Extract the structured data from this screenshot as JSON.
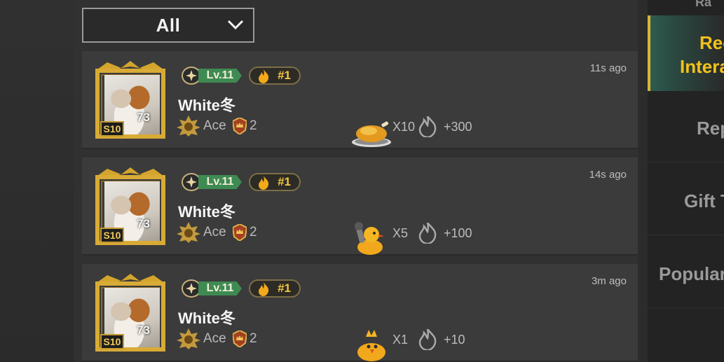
{
  "filter": {
    "selected": "All"
  },
  "entries": [
    {
      "level": "Lv.11",
      "rank": "#1",
      "username": "White冬",
      "tier": "Ace",
      "tier_number": "2",
      "avatar_score": "73",
      "season": "S10",
      "gift_icon": "roast-chicken-icon",
      "gift_count": "X10",
      "heat": "+300",
      "time_ago": "11s ago"
    },
    {
      "level": "Lv.11",
      "rank": "#1",
      "username": "White冬",
      "tier": "Ace",
      "tier_number": "2",
      "avatar_score": "73",
      "season": "S10",
      "gift_icon": "chick-with-pan-icon",
      "gift_count": "X5",
      "heat": "+100",
      "time_ago": "14s ago"
    },
    {
      "level": "Lv.11",
      "rank": "#1",
      "username": "White冬",
      "tier": "Ace",
      "tier_number": "2",
      "avatar_score": "73",
      "season": "S10",
      "gift_icon": "chick-icon",
      "gift_count": "X1",
      "heat": "+10",
      "time_ago": "3m ago"
    }
  ],
  "sidebar": {
    "top_partial": "Ra",
    "active_line1": "Rec",
    "active_line2": "Intera",
    "items": [
      "Rep",
      "Gift T",
      "Populari"
    ]
  },
  "colors": {
    "accent_gold": "#f2c21a",
    "level_green": "#3f8a52",
    "active_tab_teal": "#2f5c50"
  }
}
